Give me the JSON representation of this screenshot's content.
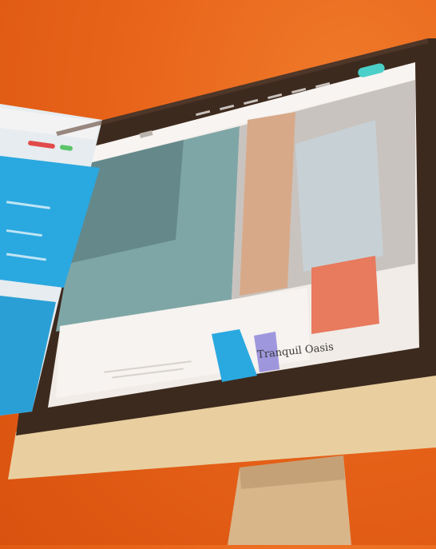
{
  "scene": {
    "background_color": "#e8641a",
    "monitor_bezel_color": "#3d2a1e",
    "monitor_chin_color": "#e9cfa0",
    "stand_color": "#d9b58a",
    "accent_blue": "#2aa8e0"
  },
  "website": {
    "hero_headline": "Tranquil Oasis",
    "hero_subline": "",
    "nav_button_color": "#4ad0c8"
  }
}
